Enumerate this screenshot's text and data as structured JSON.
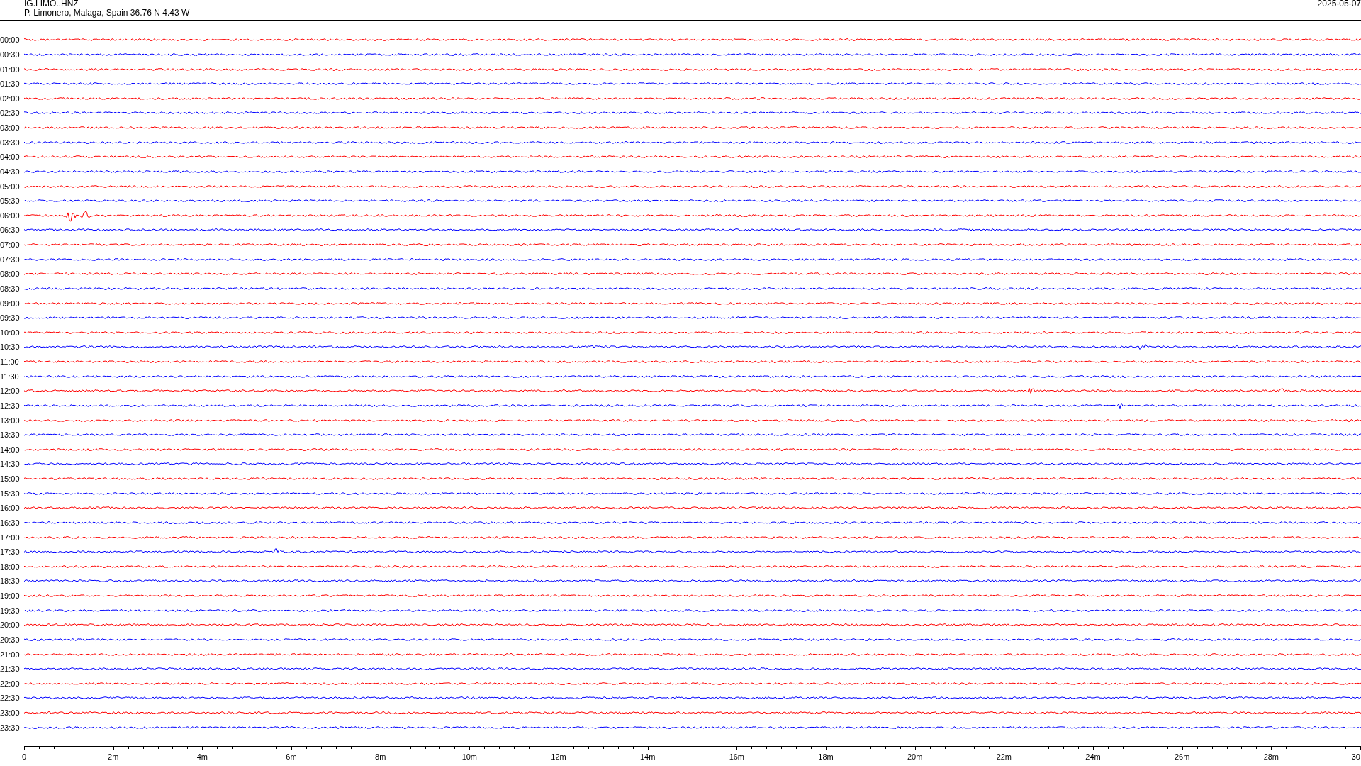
{
  "header": {
    "station": "IG.LIMO..HNZ",
    "location": "P. Limonero, Malaga, Spain  36.76 N 4.43 W",
    "date": "2025-05-07"
  },
  "rows": [
    {
      "time": "00:00",
      "color": "#ff0000"
    },
    {
      "time": "00:30",
      "color": "#0000ff"
    },
    {
      "time": "01:00",
      "color": "#ff0000"
    },
    {
      "time": "01:30",
      "color": "#0000ff"
    },
    {
      "time": "02:00",
      "color": "#ff0000"
    },
    {
      "time": "02:30",
      "color": "#0000ff"
    },
    {
      "time": "03:00",
      "color": "#ff0000"
    },
    {
      "time": "03:30",
      "color": "#0000ff"
    },
    {
      "time": "04:00",
      "color": "#ff0000"
    },
    {
      "time": "04:30",
      "color": "#0000ff"
    },
    {
      "time": "05:00",
      "color": "#ff0000"
    },
    {
      "time": "05:30",
      "color": "#0000ff"
    },
    {
      "time": "06:00",
      "color": "#ff0000"
    },
    {
      "time": "06:30",
      "color": "#0000ff"
    },
    {
      "time": "07:00",
      "color": "#ff0000"
    },
    {
      "time": "07:30",
      "color": "#0000ff"
    },
    {
      "time": "08:00",
      "color": "#ff0000"
    },
    {
      "time": "08:30",
      "color": "#0000ff"
    },
    {
      "time": "09:00",
      "color": "#ff0000"
    },
    {
      "time": "09:30",
      "color": "#0000ff"
    },
    {
      "time": "10:00",
      "color": "#ff0000"
    },
    {
      "time": "10:30",
      "color": "#0000ff"
    },
    {
      "time": "11:00",
      "color": "#ff0000"
    },
    {
      "time": "11:30",
      "color": "#0000ff"
    },
    {
      "time": "12:00",
      "color": "#ff0000"
    },
    {
      "time": "12:30",
      "color": "#0000ff"
    },
    {
      "time": "13:00",
      "color": "#ff0000"
    },
    {
      "time": "13:30",
      "color": "#0000ff"
    },
    {
      "time": "14:00",
      "color": "#ff0000"
    },
    {
      "time": "14:30",
      "color": "#0000ff"
    },
    {
      "time": "15:00",
      "color": "#ff0000"
    },
    {
      "time": "15:30",
      "color": "#0000ff"
    },
    {
      "time": "16:00",
      "color": "#ff0000"
    },
    {
      "time": "16:30",
      "color": "#0000ff"
    },
    {
      "time": "17:00",
      "color": "#ff0000"
    },
    {
      "time": "17:30",
      "color": "#0000ff"
    },
    {
      "time": "18:00",
      "color": "#ff0000"
    },
    {
      "time": "18:30",
      "color": "#0000ff"
    },
    {
      "time": "19:00",
      "color": "#ff0000"
    },
    {
      "time": "19:30",
      "color": "#0000ff"
    },
    {
      "time": "20:00",
      "color": "#ff0000"
    },
    {
      "time": "20:30",
      "color": "#0000ff"
    },
    {
      "time": "21:00",
      "color": "#ff0000"
    },
    {
      "time": "21:30",
      "color": "#0000ff"
    },
    {
      "time": "22:00",
      "color": "#ff0000"
    },
    {
      "time": "22:30",
      "color": "#0000ff"
    },
    {
      "time": "23:00",
      "color": "#ff0000"
    },
    {
      "time": "23:30",
      "color": "#0000ff"
    }
  ],
  "axis": {
    "ticks": [
      "0",
      "2m",
      "4m",
      "6m",
      "8m",
      "10m",
      "12m",
      "14m",
      "16m",
      "18m",
      "20m",
      "22m",
      "24m",
      "26m",
      "28m",
      "30"
    ]
  }
}
